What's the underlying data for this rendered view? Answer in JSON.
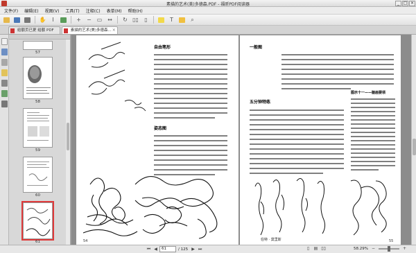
{
  "window": {
    "title": "素描的艺术(美)多德森.PDF - 福昕PDF阅读器",
    "controls": [
      "_",
      "□",
      "×"
    ]
  },
  "menu": {
    "items": [
      "文件(F)",
      "编辑(E)",
      "视图(V)",
      "工具(T)",
      "注释(C)",
      "表单(M)",
      "帮助(H)"
    ]
  },
  "tabs": [
    {
      "label": "给额页已更 给额 PDF"
    },
    {
      "label": "素描的艺术(美)多德森..."
    }
  ],
  "thumbnails": {
    "pages": [
      "57",
      "58",
      "59",
      "60",
      "61"
    ],
    "selected": "61"
  },
  "left_page": {
    "heading_1": "自由笔形",
    "heading_2": "姿态图",
    "page_number": "54"
  },
  "right_page": {
    "heading_1": "一般图",
    "heading_2": "五分钟特练",
    "sidebar_title": "图示十一——脑画要领",
    "figure_caption": "伯特 · 莫里斯",
    "page_number": "55"
  },
  "status": {
    "page_current": "61",
    "page_total": "/ 125",
    "zoom": "58.29%"
  },
  "colors": {
    "accent": "#e0393a",
    "pdf": "#c33333"
  }
}
